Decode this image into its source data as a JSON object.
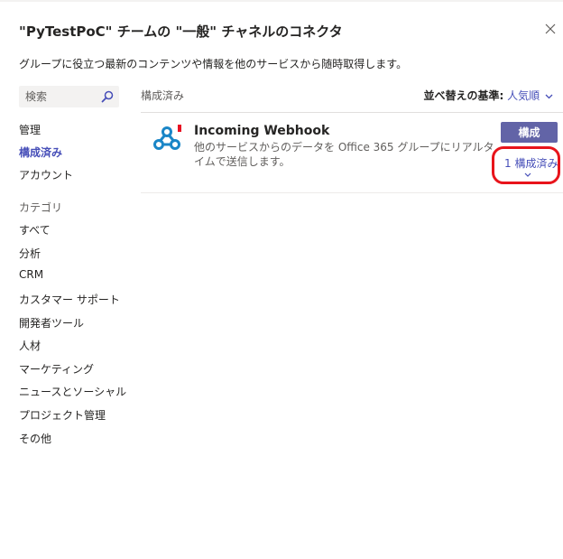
{
  "dialog": {
    "title": "\"PyTestPoC\" チームの \"一般\" チャネルのコネクタ",
    "subtitle": "グループに役立つ最新のコンテンツや情報を他のサービスから随時取得します。",
    "close_icon": "close-icon"
  },
  "search": {
    "placeholder": "検索",
    "icon": "search-icon"
  },
  "sidebar": {
    "items": [
      {
        "label": "管理"
      },
      {
        "label": "構成済み"
      },
      {
        "label": "アカウント"
      }
    ],
    "category_header": "カテゴリ",
    "categories": [
      {
        "label": "すべて"
      },
      {
        "label": "分析"
      },
      {
        "label": "CRM"
      },
      {
        "label": "カスタマー サポート"
      },
      {
        "label": "開発者ツール"
      },
      {
        "label": "人材"
      },
      {
        "label": "マーケティング"
      },
      {
        "label": "ニュースとソーシャル"
      },
      {
        "label": "プロジェクト管理"
      },
      {
        "label": "その他"
      }
    ]
  },
  "main": {
    "section_title": "構成済み",
    "sort_label": "並べ替えの基準:",
    "sort_value": "人気順",
    "connector": {
      "name": "Incoming Webhook",
      "description": "他のサービスからのデータを Office 365 グループにリアルタイムで送信します。",
      "configure_label": "構成",
      "configured_count_label": "1 構成済み",
      "icon": "webhook-icon"
    }
  },
  "colors": {
    "accent": "#6264a7",
    "link": "#464eb8",
    "webhook": "#1a86c7",
    "badge": "#e81123",
    "highlight": "#e8141b"
  }
}
